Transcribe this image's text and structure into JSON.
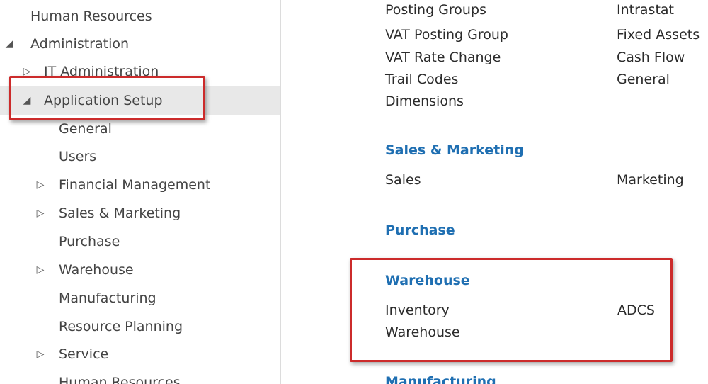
{
  "nav": {
    "items": [
      {
        "label": "Human Resources",
        "arrow": ""
      },
      {
        "label": "Administration",
        "arrow": "◢"
      },
      {
        "label": "IT Administration",
        "arrow": "▷"
      },
      {
        "label": "Application Setup",
        "arrow": "◢"
      },
      {
        "label": "General",
        "arrow": ""
      },
      {
        "label": "Users",
        "arrow": ""
      },
      {
        "label": "Financial Management",
        "arrow": "▷"
      },
      {
        "label": "Sales & Marketing",
        "arrow": "▷"
      },
      {
        "label": "Purchase",
        "arrow": ""
      },
      {
        "label": "Warehouse",
        "arrow": "▷"
      },
      {
        "label": "Manufacturing",
        "arrow": ""
      },
      {
        "label": "Resource Planning",
        "arrow": ""
      },
      {
        "label": "Service",
        "arrow": "▷"
      },
      {
        "label": "Human Resources",
        "arrow": ""
      }
    ]
  },
  "content": {
    "financial": {
      "col1": [
        "Posting Groups",
        "VAT Posting Group",
        "VAT Rate Change",
        "Trail Codes",
        "Dimensions"
      ],
      "col2": [
        "Intrastat",
        "Fixed Assets",
        "Cash Flow",
        "General"
      ]
    },
    "sales_marketing": {
      "heading": "Sales & Marketing",
      "col1": [
        "Sales"
      ],
      "col2": [
        "Marketing"
      ]
    },
    "purchase": {
      "heading": "Purchase"
    },
    "warehouse": {
      "heading": "Warehouse",
      "col1": [
        "Inventory",
        "Warehouse"
      ],
      "col2": [
        "ADCS"
      ]
    },
    "manufacturing": {
      "heading": "Manufacturing"
    }
  },
  "colors": {
    "heading": "#1f6fb2",
    "highlight": "#cc2b2b",
    "selected_bg": "#e8e8e8"
  }
}
